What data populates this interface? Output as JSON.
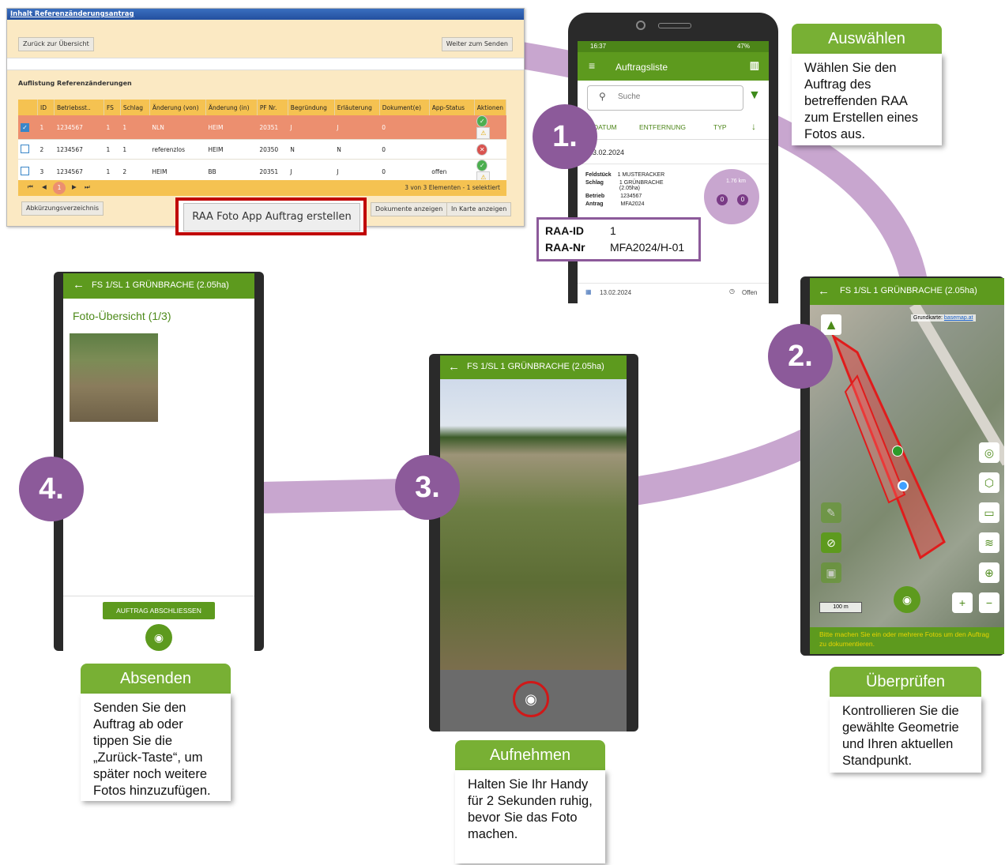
{
  "desktop": {
    "title_link": "Inhalt Referenzänderungsantrag",
    "back_button": "Zurück zur Übersicht",
    "next_button": "Weiter zum Senden",
    "section_title": "Auflistung Referenzänderungen",
    "columns": [
      "",
      "ID",
      "Betriebsst..",
      "FS",
      "Schlag",
      "Änderung (von)",
      "Änderung (in)",
      "PF Nr.",
      "Begründung",
      "Erläuterung",
      "Dokument(e)",
      "App-Status",
      "Aktionen"
    ],
    "rows": [
      {
        "id": "1",
        "betrieb": "1234567",
        "fs": "1",
        "schlag": "1",
        "von": "NLN",
        "in": "HEIM",
        "pf": "20351",
        "begr": "J",
        "erl": "J",
        "dok": "0",
        "status": ""
      },
      {
        "id": "2",
        "betrieb": "1234567",
        "fs": "1",
        "schlag": "1",
        "von": "referenzlos",
        "in": "HEIM",
        "pf": "20350",
        "begr": "N",
        "erl": "N",
        "dok": "0",
        "status": ""
      },
      {
        "id": "3",
        "betrieb": "1234567",
        "fs": "1",
        "schlag": "2",
        "von": "HEIM",
        "in": "BB",
        "pf": "20351",
        "begr": "J",
        "erl": "J",
        "dok": "0",
        "status": "offen"
      }
    ],
    "pager": {
      "first": "⏮",
      "prev": "◀",
      "page": "1",
      "next": "▶",
      "last": "⏭",
      "info": "3 von 3 Elementen - 1 selektiert"
    },
    "abbrev_button": "Abkürzungsverzeichnis",
    "create_button": "RAA Foto App Auftrag erstellen",
    "docs_button": "Dokumente anzeigen",
    "map_button": "In Karte anzeigen"
  },
  "phone1": {
    "status_time": "16:37",
    "status_right": "47%",
    "title": "Auftragsliste",
    "search_placeholder": "Suche",
    "tabs": [
      "DATUM",
      "ENTFERNUNG",
      "TYP"
    ],
    "date": "13.02.2024",
    "fields": [
      {
        "label": "Feldstück",
        "value": "1  MUSTERACKER"
      },
      {
        "label": "Schlag",
        "value": "1  GRÜNBRACHE (2.05ha)"
      },
      {
        "label": "Betrieb",
        "value": "1234567"
      },
      {
        "label": "Antrag",
        "value": "MFA2024"
      }
    ],
    "distance": "1.76 km",
    "badge1": "0",
    "badge2": "0",
    "raa_id_label": "RAA-ID",
    "raa_id_value": "1",
    "raa_nr_label": "RAA-Nr",
    "raa_nr_value": "MFA2024/H-01",
    "footer_date": "13.02.2024",
    "footer_status": "Offen"
  },
  "phone2": {
    "title": "FS 1/SL 1 GRÜNBRACHE (2.05ha)",
    "attribution_label": "Grundkarte:",
    "attribution_link": "basemap.at",
    "scale": "100 m",
    "hint": "Bitte machen Sie ein oder mehrere Fotos um den Auftrag zu dokumentieren."
  },
  "phone3": {
    "title": "FS 1/SL 1 GRÜNBRACHE (2.05ha)"
  },
  "phone4": {
    "title": "FS 1/SL 1 GRÜNBRACHE (2.05ha)",
    "overview": "Foto-Übersicht (1/3)",
    "finish_button": "AUFTRAG ABSCHLIESSEN"
  },
  "steps": {
    "s1": "1.",
    "s2": "2.",
    "s3": "3.",
    "s4": "4."
  },
  "callouts": {
    "auswaehlen_title": "Auswählen",
    "auswaehlen_text": "Wählen Sie den Auftrag des betreffenden RAA zum Erstellen eines Fotos aus.",
    "ueberpruefen_title": "Überprüfen",
    "ueberpruefen_text": "Kontrollieren Sie die gewählte Geometrie und Ihren aktuellen Standpunkt.",
    "aufnehmen_title": "Aufnehmen",
    "aufnehmen_text": "Halten Sie Ihr Handy für 2 Sekunden ruhig, bevor Sie das Foto machen.",
    "absenden_title": "Absenden",
    "absenden_text": "Senden Sie den Auftrag ab oder tippen Sie die „Zurück-Taste“, um später noch weitere Fotos hinzuzufügen."
  },
  "colors": {
    "green": "#78b034",
    "dark_green": "#5d9a1e",
    "purple": "#8c5a9a",
    "ribbon": "#c8a6cf",
    "highlight_red": "#c00000"
  }
}
